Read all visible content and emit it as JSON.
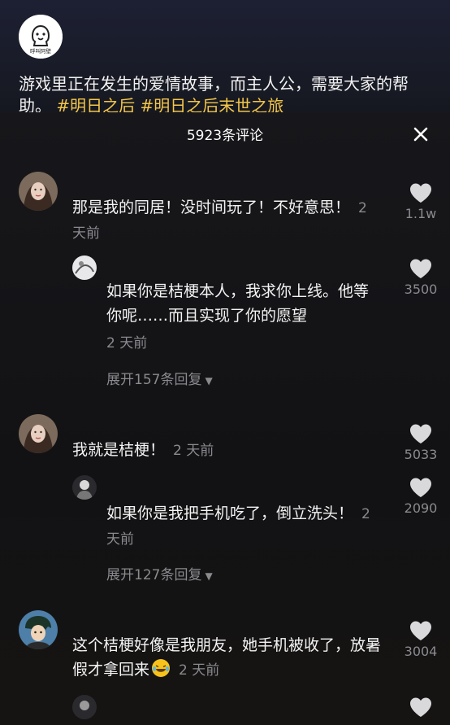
{
  "post": {
    "account_logo_text": "呼叫阿壁",
    "caption": "游戏里正在发生的爱情故事，而主人公，需要大家的帮助。",
    "tags": "#明日之后 #明日之后末世之旅"
  },
  "comments_sheet": {
    "title": "5923条评论",
    "close_icon": "close-icon"
  },
  "comments": [
    {
      "text": "那是我的同居！没时间玩了！不好意思！",
      "time": "2 天前",
      "likes": "1.1w",
      "reply": {
        "text": "如果你是桔梗本人，我求你上线。他等你呢……而且实现了你的愿望",
        "time": "2 天前",
        "likes": "3500"
      },
      "expand": "展开157条回复"
    },
    {
      "text": "我就是桔梗！",
      "time": "2 天前",
      "likes": "5033",
      "reply": {
        "text": "如果你是我把手机吃了，倒立洗头！",
        "time": "2 天前",
        "likes": "2090"
      },
      "expand": "展开127条回复"
    },
    {
      "text": "这个桔梗好像是我朋友，她手机被收了，放暑假才拿回来",
      "emoji": "laughing-tears-emoji",
      "time": "2 天前",
      "likes": "3004"
    }
  ],
  "colors": {
    "tag": "#f4c648",
    "secondary_text": "#8a8a8f",
    "heart": "#d9d9dc"
  }
}
